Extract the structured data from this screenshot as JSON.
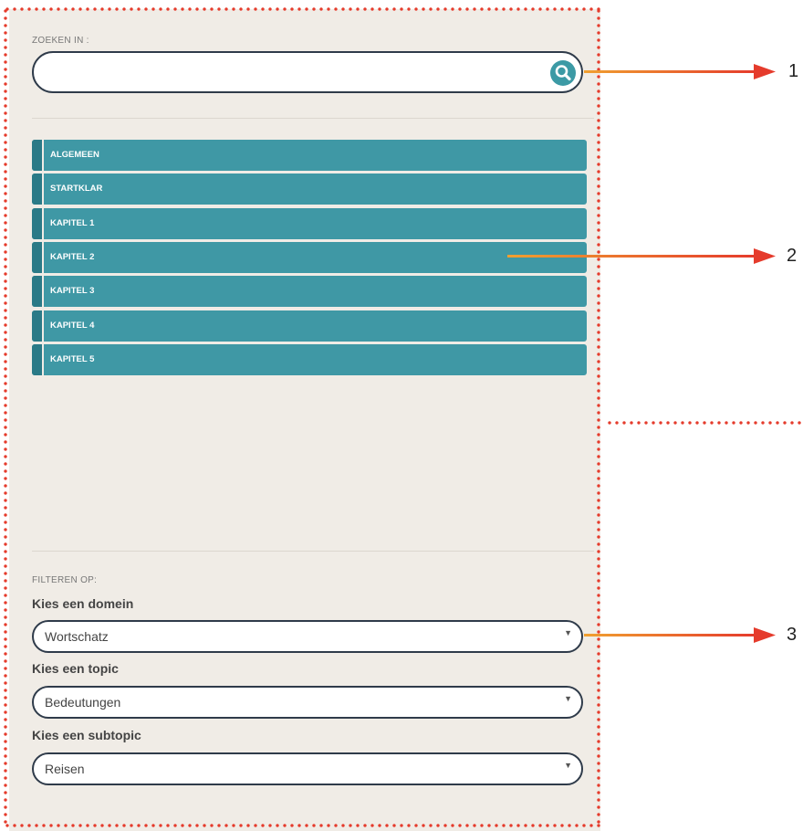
{
  "search": {
    "label": "ZOEKEN IN :",
    "value": "",
    "placeholder": ""
  },
  "nav": {
    "items": [
      {
        "label": "ALGEMEEN"
      },
      {
        "label": "STARTKLAR"
      },
      {
        "label": "KAPITEL 1"
      },
      {
        "label": "KAPITEL 2"
      },
      {
        "label": "KAPITEL 3"
      },
      {
        "label": "KAPITEL 4"
      },
      {
        "label": "KAPITEL 5"
      }
    ]
  },
  "filter": {
    "label": "FILTEREN OP:",
    "domain": {
      "title": "Kies een domein",
      "value": "Wortschatz"
    },
    "topic": {
      "title": "Kies een topic",
      "value": "Bedeutungen"
    },
    "subtopic": {
      "title": "Kies een subtopic",
      "value": "Reisen"
    }
  },
  "callouts": [
    "1",
    "2",
    "3"
  ],
  "colors": {
    "accent": "#3f98a5",
    "dots": "#e53b2c",
    "arrow_start": "#f0a030",
    "arrow_end": "#e53b2c"
  },
  "icons": {
    "search": "magnifier-icon",
    "dropdown": "caret-down-icon"
  }
}
